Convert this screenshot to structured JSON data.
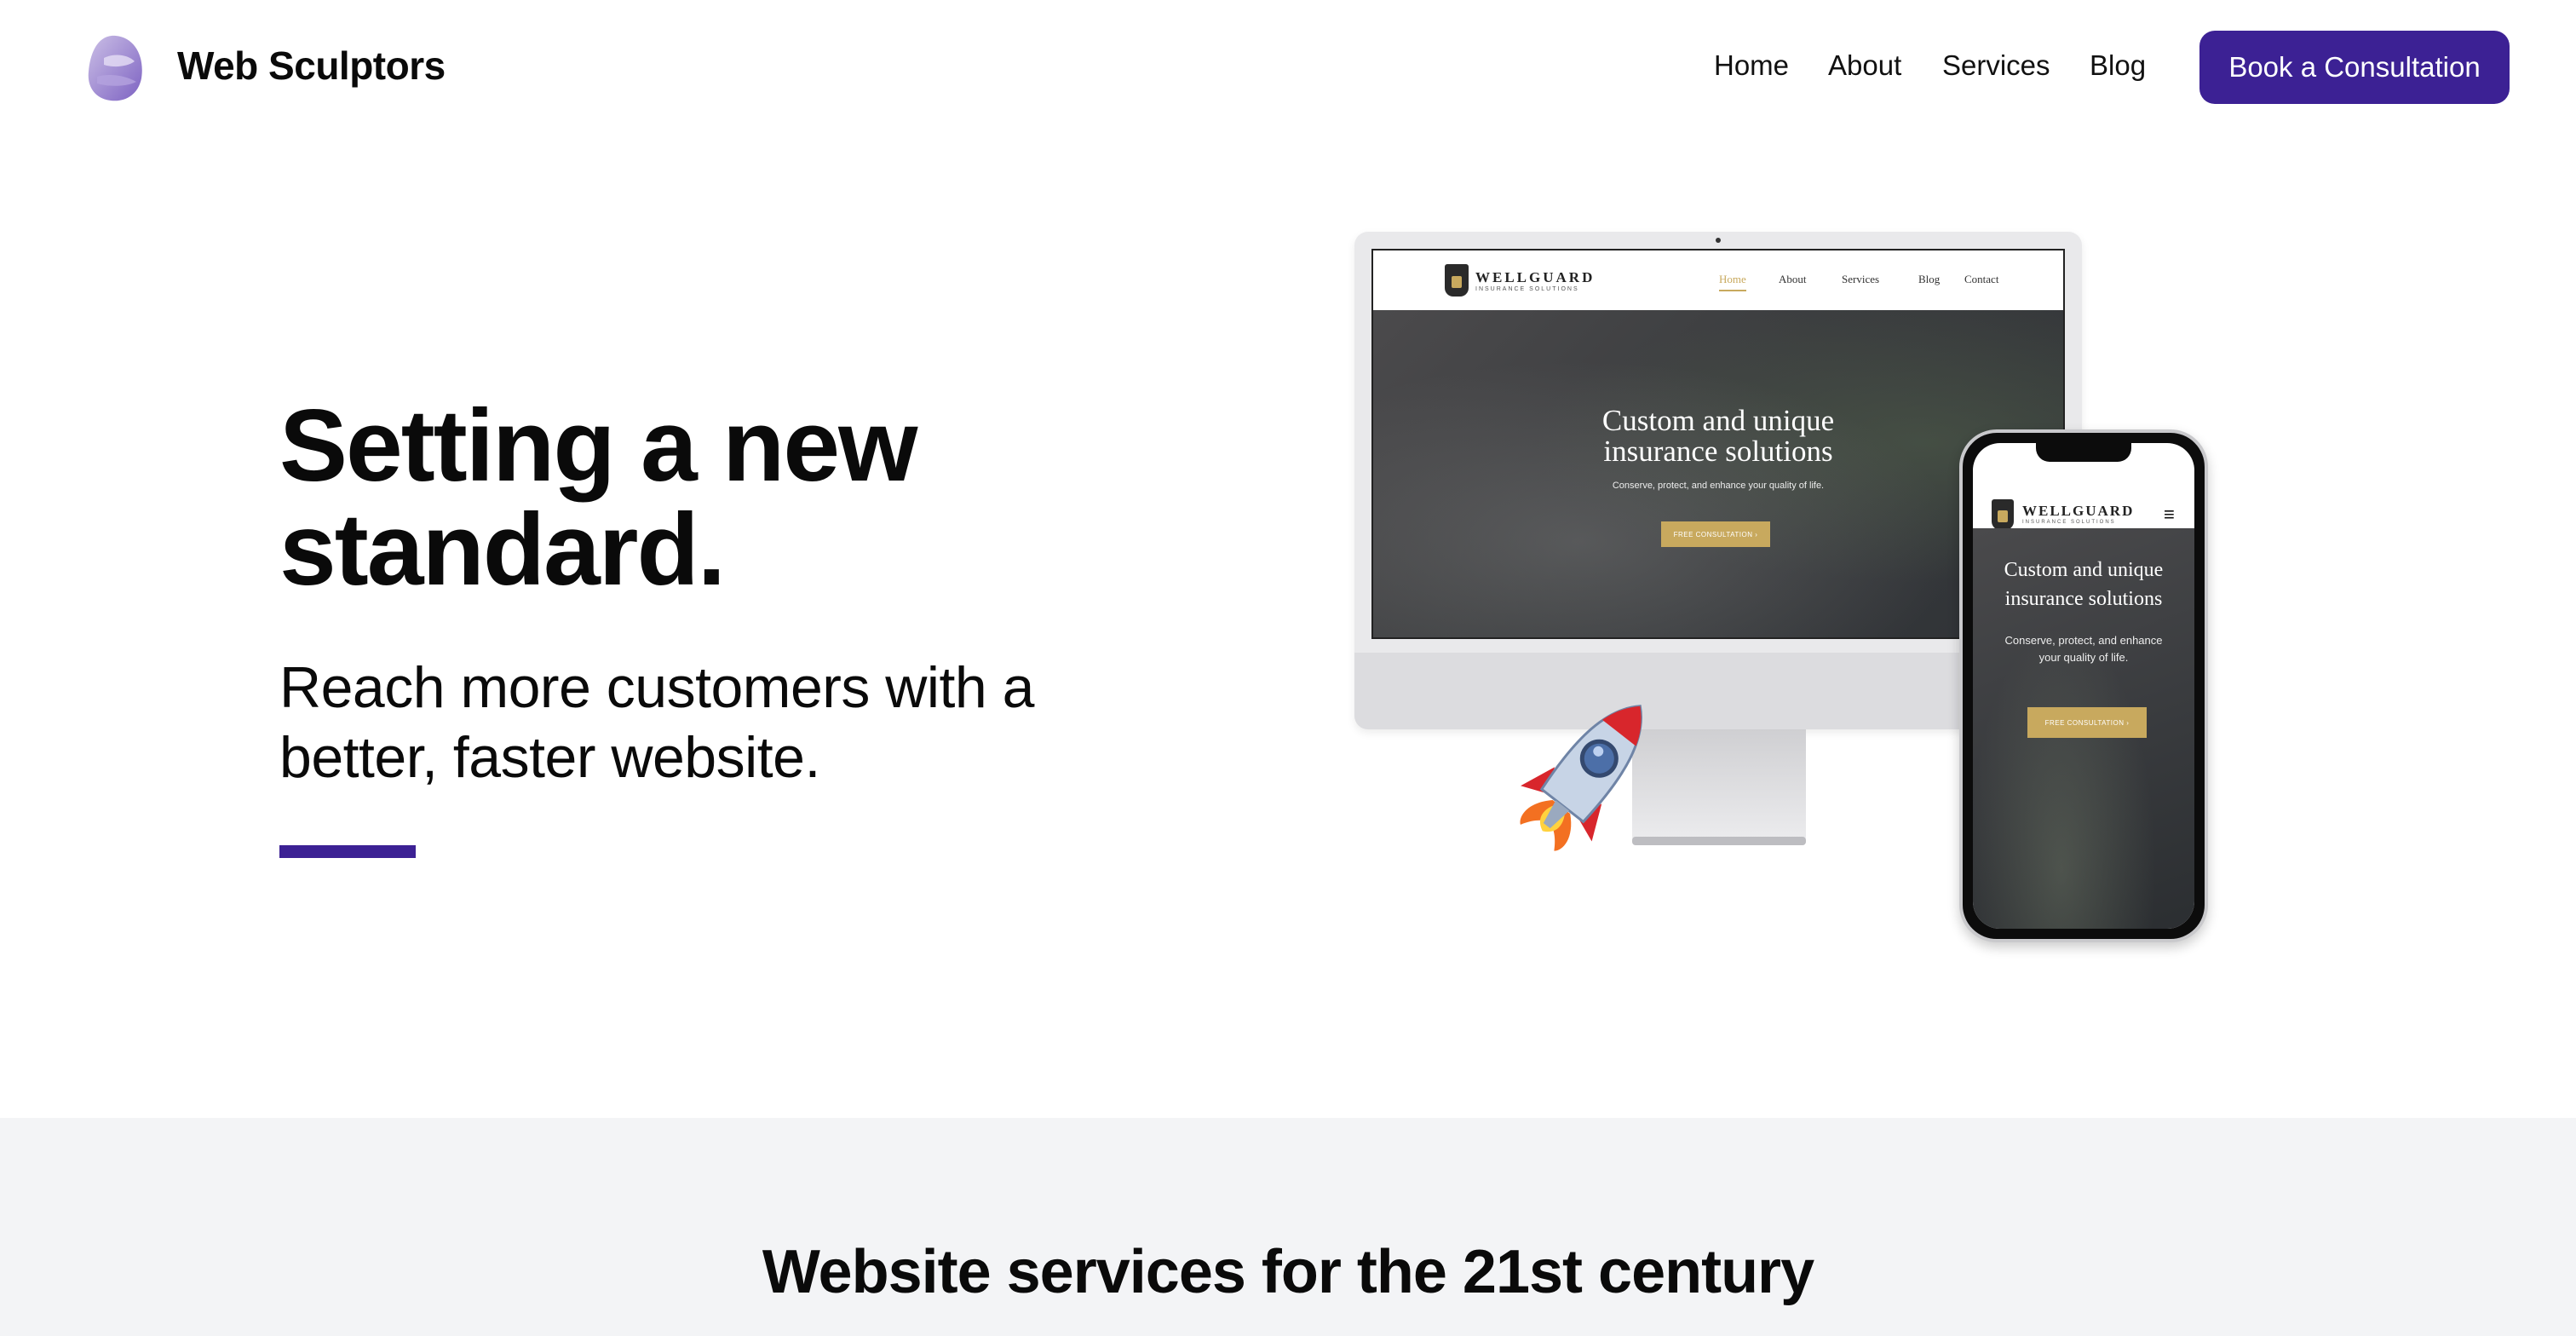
{
  "header": {
    "brand": "Web Sculptors",
    "nav": [
      "Home",
      "About",
      "Services",
      "Blog"
    ],
    "cta": "Book a Consultation"
  },
  "hero": {
    "title_line1": "Setting a new",
    "title_line2": "standard.",
    "subtitle_line1": "Reach more customers with a",
    "subtitle_line2": "better, faster website."
  },
  "mockup": {
    "brand": "WELLGUARD",
    "tagline": "INSURANCE SOLUTIONS",
    "nav": [
      "Home",
      "About",
      "Services",
      "Blog",
      "Contact"
    ],
    "hero_line1": "Custom and unique",
    "hero_line2": "insurance solutions",
    "hero_sub": "Conserve, protect, and enhance your quality of life.",
    "hero_btn": "FREE CONSULTATION  ›",
    "phone_sub_line1": "Conserve, protect, and enhance",
    "phone_sub_line2": "your quality of life."
  },
  "services": {
    "title": "Website services for the 21st century"
  },
  "colors": {
    "accent": "#3c2194",
    "gold": "#c8a95e",
    "band": "#f3f4f6"
  },
  "icons": [
    "logo-mark-icon",
    "rocket-icon",
    "hamburger-menu-icon"
  ]
}
